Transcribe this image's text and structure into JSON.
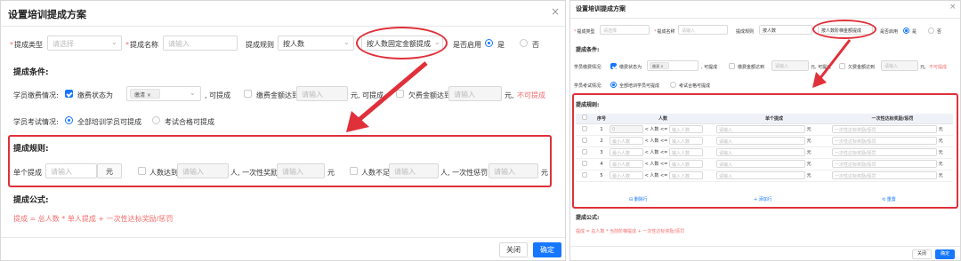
{
  "left": {
    "title": "设置培训提成方案",
    "close_icon": "×",
    "form": {
      "type_label": "提成类型",
      "type_placeholder": "请选择",
      "name_label": "提成名称",
      "name_placeholder": "请输入",
      "rule_label": "提成规则",
      "rule_value": "按人数",
      "rule2_value": "按人数固定金额提成",
      "enable_label": "是否启用",
      "yes": "是",
      "no": "否"
    },
    "cond_title": "提成条件:",
    "pay_label": "学员缴费情况:",
    "pay_status_label": "缴费状态为",
    "pay_status_tag": "缴清",
    "can": ", 可提成",
    "paid_amount_label": "缴费金额达到",
    "owe_label": "欠费金额达到",
    "input_ph": "请输入",
    "yuan": "元",
    "yuan_can": "元, 可提成",
    "yuan_cannot": "元,",
    "cannot": "不可提成",
    "exam_label": "学员考试情况:",
    "exam_all": "全部培训学员可提成",
    "exam_pass": "考试合格可提成",
    "rules_title": "提成规则:",
    "single_label": "单个提成",
    "reach_label": "人数达到",
    "bonus_label": "人, 一次性奖励",
    "under_label": "人数不足",
    "penalty_label": "人, 一次性惩罚",
    "formula_title": "提成公式:",
    "formula": "提成 = 总人数 * 单人提成 + 一次性达标奖励/惩罚",
    "close_btn": "关闭",
    "ok_btn": "确定"
  },
  "right": {
    "title": "设置培训提成方案",
    "close_icon": "×",
    "form": {
      "type_label": "提成类型",
      "type_placeholder": "请选择",
      "name_label": "提成名称",
      "name_placeholder": "请输入",
      "rule_label": "提成规则",
      "rule_value": "按人数",
      "rule2_value": "按人数阶梯金额提成",
      "enable_label": "是否启用",
      "yes": "是",
      "no": "否"
    },
    "cond_title": "提成条件:",
    "pay_label": "学员缴费情况:",
    "pay_status_label": "缴费状态为",
    "pay_status_tag": "缴清",
    "can": ", 可提成",
    "paid_amount_label": "缴费金额达到",
    "owe_label": "欠费金额达到",
    "input_ph": "请输入",
    "yuan_can": "元, 可提成",
    "yuan_cannot": "元,",
    "cannot": "不可提成",
    "exam_label": "学员考试情况:",
    "exam_all": "全部培训学员可提成",
    "exam_pass": "考试合格可提成",
    "rules_title": "提成规则:",
    "table": {
      "headers": [
        "序号",
        "人数",
        "单个提成",
        "一次性达标奖励/惩罚"
      ],
      "rows": [
        {
          "no": "1",
          "from": "0",
          "op": "< 人数 <=",
          "to": "输入人数"
        },
        {
          "no": "2",
          "from": "最小人数",
          "op": "< 人数 <=",
          "to": "输入人数"
        },
        {
          "no": "3",
          "from": "最小人数",
          "op": "< 人数 <=",
          "to": "输入人数"
        },
        {
          "no": "4",
          "from": "最小人数",
          "op": "< 人数 <=",
          "to": "输入人数"
        },
        {
          "no": "5",
          "from": "最小人数",
          "op": "< 人数 <=",
          "to": "输入人数"
        }
      ],
      "cell_ph": "请输入",
      "cell_ph2": "一次性达标奖励/惩罚",
      "unit": "元",
      "delete_row": "删除行",
      "add_row": "添加行",
      "reset": "重置"
    },
    "formula_title": "提成公式:",
    "formula": "提成 = 总人数 * 当前阶梯提成 + 一次性达标奖励/惩罚",
    "close_btn": "关闭",
    "ok_btn": "确定"
  },
  "colors": {
    "accent": "#1677ff",
    "annotation": "#e0303a",
    "warning": "#f56c6c"
  }
}
